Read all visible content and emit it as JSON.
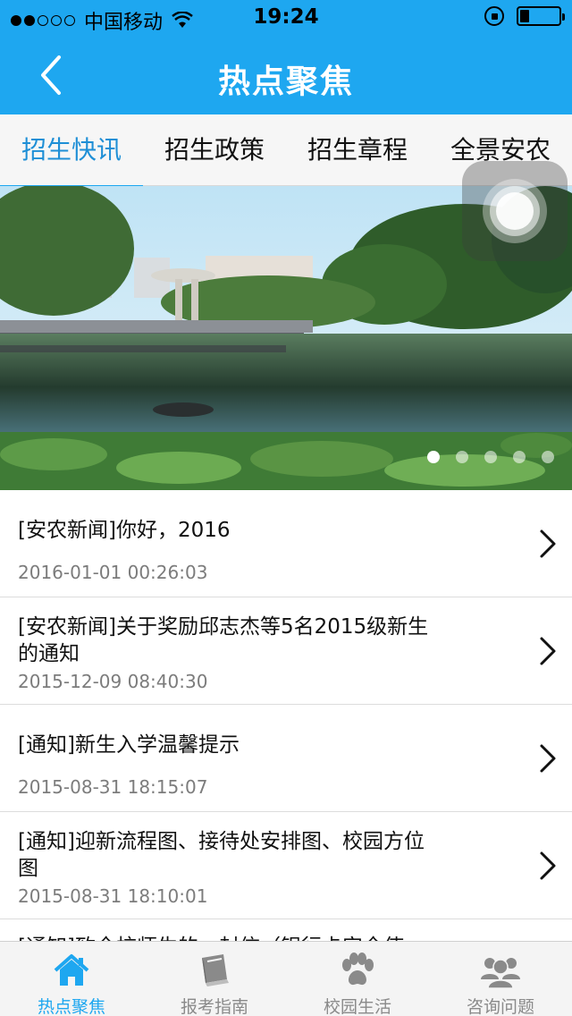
{
  "status_bar": {
    "carrier": "中国移动",
    "time": "19:24"
  },
  "nav": {
    "title": "热点聚焦",
    "back_icon": "chevron-left-icon"
  },
  "tabs": [
    {
      "label": "招生快讯",
      "active": true
    },
    {
      "label": "招生政策",
      "active": false
    },
    {
      "label": "招生章程",
      "active": false
    },
    {
      "label": "全景安农",
      "active": false
    }
  ],
  "banner": {
    "slide_count": 5,
    "active_index": 0
  },
  "news": [
    {
      "title": "[安农新闻]你好，2016",
      "date": "2016-01-01 00:26:03"
    },
    {
      "title": "[安农新闻]关于奖励邱志杰等5名2015级新生的通知",
      "date": "2015-12-09 08:40:30"
    },
    {
      "title": "[通知]新生入学温馨提示",
      "date": "2015-08-31 18:15:07"
    },
    {
      "title": "[通知]迎新流程图、接待处安排图、校园方位图",
      "date": "2015-08-31 18:10:01"
    },
    {
      "title": "[通知]致全校师生的一封信（银行卡安全使",
      "date": ""
    }
  ],
  "bottom_tabs": [
    {
      "label": "热点聚焦",
      "icon": "home-icon",
      "active": true
    },
    {
      "label": "报考指南",
      "icon": "book-icon",
      "active": false
    },
    {
      "label": "校园生活",
      "icon": "paw-icon",
      "active": false
    },
    {
      "label": "咨询问题",
      "icon": "users-icon",
      "active": false
    }
  ],
  "colors": {
    "primary": "#1ea7f0",
    "tab_active": "#1e8fd6",
    "date_gray": "#7c7c7c"
  }
}
